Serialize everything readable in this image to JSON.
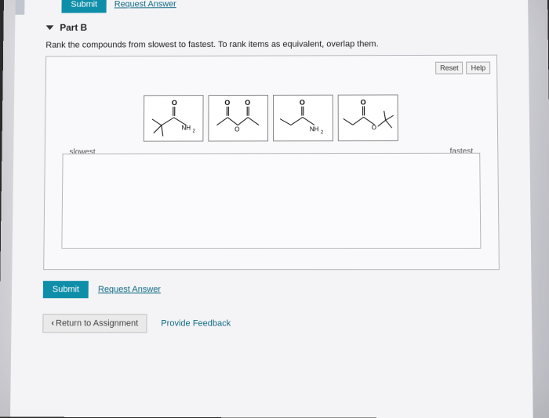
{
  "topbar": {
    "submit": "Submit",
    "request": "Request Answer"
  },
  "part": {
    "label": "Part B"
  },
  "instruction": "Rank the compounds from slowest to fastest. To rank items as equivalent, overlap them.",
  "tools": {
    "reset": "Reset",
    "help": "Help"
  },
  "axis": {
    "slow": "slowest",
    "fast": "fastest"
  },
  "tiles": [
    {
      "name": "compound-1",
      "label": "NH₂"
    },
    {
      "name": "compound-2",
      "label": ""
    },
    {
      "name": "compound-3",
      "label": "NH₂"
    },
    {
      "name": "compound-4",
      "label": ""
    }
  ],
  "bottombar": {
    "submit": "Submit",
    "request": "Request Answer"
  },
  "footer": {
    "return": "Return to Assignment",
    "feedback": "Provide Feedback"
  }
}
